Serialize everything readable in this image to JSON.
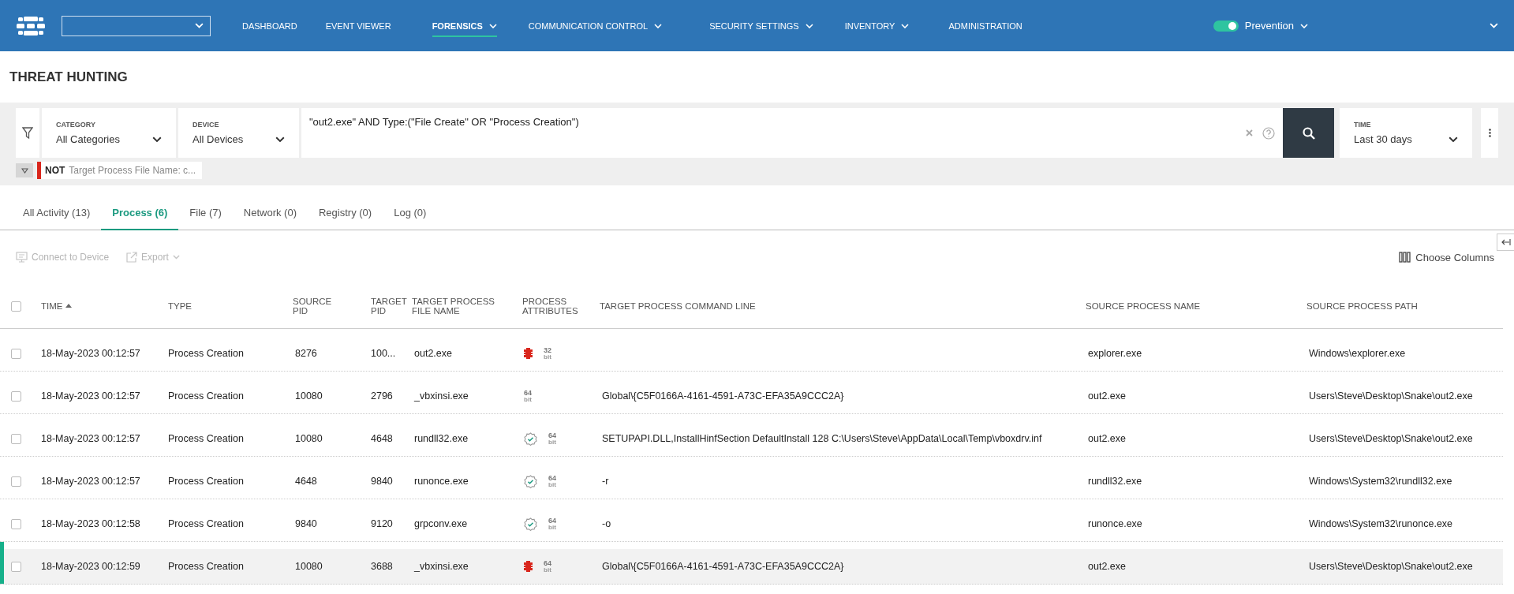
{
  "header": {
    "nav": [
      {
        "label": "DASHBOARD",
        "dropdown": false,
        "selected": false
      },
      {
        "label": "EVENT VIEWER",
        "dropdown": false,
        "selected": false
      },
      {
        "label": "FORENSICS",
        "dropdown": true,
        "selected": true
      },
      {
        "label": "COMMUNICATION CONTROL",
        "dropdown": true,
        "selected": false
      },
      {
        "label": "SECURITY SETTINGS",
        "dropdown": true,
        "selected": false
      },
      {
        "label": "INVENTORY",
        "dropdown": true,
        "selected": false
      },
      {
        "label": "ADMINISTRATION",
        "dropdown": false,
        "selected": false
      }
    ],
    "mode_toggle": {
      "label": "Prevention",
      "on": true
    }
  },
  "page_title": "THREAT HUNTING",
  "filters": {
    "category": {
      "label": "CATEGORY",
      "value": "All Categories"
    },
    "device": {
      "label": "DEVICE",
      "value": "All Devices"
    },
    "query": "\"out2.exe\" AND Type:(\"File Create\" OR \"Process Creation\")",
    "time": {
      "label": "TIME",
      "value": "Last 30 days"
    },
    "conditions": [
      {
        "operator": "NOT",
        "text": "Target Process File Name: c..."
      }
    ]
  },
  "tabs": [
    {
      "label": "All Activity (13)",
      "selected": false
    },
    {
      "label": "Process (6)",
      "selected": true
    },
    {
      "label": "File (7)",
      "selected": false
    },
    {
      "label": "Network (0)",
      "selected": false
    },
    {
      "label": "Registry (0)",
      "selected": false
    },
    {
      "label": "Log (0)",
      "selected": false
    }
  ],
  "toolbar": {
    "connect": {
      "label": "Connect to Device",
      "disabled": true
    },
    "export": {
      "label": "Export",
      "disabled": true
    },
    "choose_columns": "Choose Columns"
  },
  "table": {
    "all_checked": false,
    "columns": [
      {
        "label": "TIME",
        "sorted": true
      },
      {
        "label": "TYPE",
        "sorted": false
      },
      {
        "label": "SOURCE PID",
        "sorted": false
      },
      {
        "label": "TARGET PID",
        "sorted": false
      },
      {
        "label": "TARGET PROCESS FILE NAME",
        "sorted": false
      },
      {
        "label": "PROCESS ATTRIBUTES",
        "sorted": false
      },
      {
        "label": "TARGET PROCESS COMMAND LINE",
        "sorted": false
      },
      {
        "label": "SOURCE PROCESS NAME",
        "sorted": false
      },
      {
        "label": "SOURCE PROCESS PATH",
        "sorted": false
      }
    ],
    "rows": [
      {
        "checked": false,
        "selected": false,
        "time": "18-May-2023 00:12:57",
        "type": "Process Creation",
        "source_pid": "8276",
        "target_pid": "100...",
        "file_name": "out2.exe",
        "threat": true,
        "signed": false,
        "arch": "32",
        "arch_unit": "bit",
        "source_name": "explorer.exe",
        "source_path": "Windows\\explorer.exe"
      },
      {
        "checked": false,
        "selected": false,
        "time": "18-May-2023 00:12:57",
        "type": "Process Creation",
        "source_pid": "10080",
        "target_pid": "2796",
        "file_name": "_vbxinsi.exe",
        "threat": false,
        "signed": false,
        "arch": "64",
        "arch_unit": "bit",
        "command_line": "Global\\{C5F0166A-4161-4591-A73C-EFA35A9CCC2A}",
        "source_name": "out2.exe",
        "source_path": "Users\\Steve\\Desktop\\Snake\\out2.exe"
      },
      {
        "checked": false,
        "selected": false,
        "time": "18-May-2023 00:12:57",
        "type": "Process Creation",
        "source_pid": "10080",
        "target_pid": "4648",
        "file_name": "rundll32.exe",
        "threat": false,
        "signed": true,
        "arch": "64",
        "arch_unit": "bit",
        "command_line": "SETUPAPI.DLL,InstallHinfSection DefaultInstall 128 C:\\Users\\Steve\\AppData\\Local\\Temp\\vboxdrv.inf",
        "source_name": "out2.exe",
        "source_path": "Users\\Steve\\Desktop\\Snake\\out2.exe"
      },
      {
        "checked": false,
        "selected": false,
        "time": "18-May-2023 00:12:57",
        "type": "Process Creation",
        "source_pid": "4648",
        "target_pid": "9840",
        "file_name": "runonce.exe",
        "threat": false,
        "signed": true,
        "arch": "64",
        "arch_unit": "bit",
        "command_line": "-r",
        "source_name": "rundll32.exe",
        "source_path": "Windows\\System32\\rundll32.exe"
      },
      {
        "checked": false,
        "selected": false,
        "time": "18-May-2023 00:12:58",
        "type": "Process Creation",
        "source_pid": "9840",
        "target_pid": "9120",
        "file_name": "grpconv.exe",
        "threat": false,
        "signed": true,
        "arch": "64",
        "arch_unit": "bit",
        "command_line": "-o",
        "source_name": "runonce.exe",
        "source_path": "Windows\\System32\\runonce.exe"
      },
      {
        "checked": false,
        "selected": true,
        "time": "18-May-2023 00:12:59",
        "type": "Process Creation",
        "source_pid": "10080",
        "target_pid": "3688",
        "file_name": "_vbxinsi.exe",
        "threat": true,
        "signed": false,
        "arch": "64",
        "arch_unit": "bit",
        "command_line": "Global\\{C5F0166A-4161-4591-A73C-EFA35A9CCC2A}",
        "source_name": "out2.exe",
        "source_path": "Users\\Steve\\Desktop\\Snake\\out2.exe"
      }
    ]
  }
}
